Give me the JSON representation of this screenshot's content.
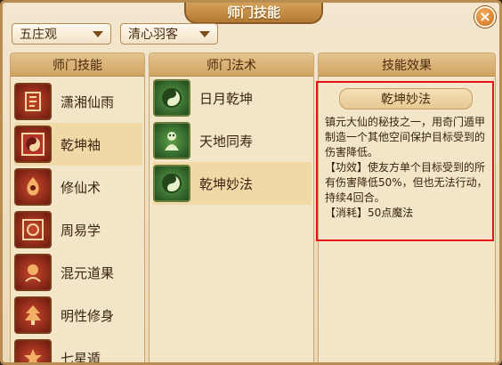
{
  "window": {
    "title": "师门技能",
    "close_label": "×"
  },
  "filters": {
    "sect": "五庄观",
    "role": "清心羽客"
  },
  "columns": {
    "skills_header": "师门技能",
    "spells_header": "师门法术",
    "effect_header": "技能效果"
  },
  "skills": [
    {
      "label": "潇湘仙雨",
      "icon": "scroll-glyph-icon"
    },
    {
      "label": "乾坤袖",
      "icon": "yin-yang-icon"
    },
    {
      "label": "修仙术",
      "icon": "flame-figure-icon"
    },
    {
      "label": "周易学",
      "icon": "bagua-icon"
    },
    {
      "label": "混元道果",
      "icon": "orb-icon"
    },
    {
      "label": "明性修身",
      "icon": "pine-icon"
    },
    {
      "label": "七星遁",
      "icon": "star-icon"
    }
  ],
  "spells": [
    {
      "label": "日月乾坤",
      "icon": "yin-yang-icon"
    },
    {
      "label": "天地同寿",
      "icon": "creature-icon"
    },
    {
      "label": "乾坤妙法",
      "icon": "yin-yang-icon"
    }
  ],
  "effect": {
    "name": "乾坤妙法",
    "description": "镇元大仙的秘技之一，用奇门遁甲制造一个其他空间保护目标受到的伤害降低。",
    "effect_line": "【功效】使友方单个目标受到的所有伤害降低50%，但也无法行动，持续4回合。",
    "cost_line": "【消耗】50点魔法"
  },
  "colors": {
    "highlight_border": "#e5141b",
    "selected_row": "#f0d9a6"
  }
}
